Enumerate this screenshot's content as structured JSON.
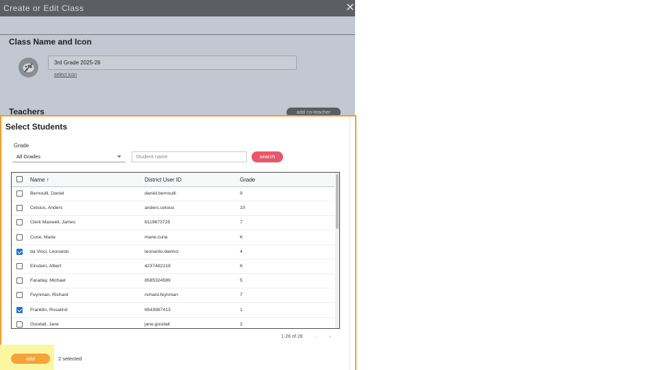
{
  "background_modal": {
    "title": "Create or Edit Class",
    "close_glyph": "✕",
    "section_title": "Class Name and Icon",
    "class_name_value": "3rd Grade 2025-26",
    "select_icon_link": "select icon",
    "teachers_title": "Teachers",
    "add_coteacher_button": "add co-teacher",
    "icon": "palette-icon"
  },
  "panel": {
    "title": "Select Students",
    "grade_label": "Grade",
    "grade_selected": "All Grades",
    "name_placeholder": "Student name",
    "search_button": "search",
    "columns": {
      "name": "Name",
      "sort_glyph": "↑",
      "id": "District User ID",
      "grade": "Grade"
    },
    "rows": [
      {
        "name": "Bernoulli, Daniel",
        "id": "daniel.bernoulli",
        "grade": "9",
        "checked": false
      },
      {
        "name": "Celsius, Anders",
        "id": "anders.celsius",
        "grade": "10",
        "checked": false
      },
      {
        "name": "Clerk Maxwell, James",
        "id": "6119673725",
        "grade": "7",
        "checked": false
      },
      {
        "name": "Curie, Marie",
        "id": "marie.curie",
        "grade": "K",
        "checked": false
      },
      {
        "name": "da Vinci, Leonardo",
        "id": "leonardo.davinci",
        "grade": "4",
        "checked": true
      },
      {
        "name": "Einstein, Albert",
        "id": "4237482219",
        "grade": "K",
        "checked": false
      },
      {
        "name": "Faraday, Michael",
        "id": "8585324589",
        "grade": "5",
        "checked": false
      },
      {
        "name": "Feynman, Richard",
        "id": "richard.feynman",
        "grade": "7",
        "checked": false
      },
      {
        "name": "Franklin, Rosalind",
        "id": "6543987413",
        "grade": "1",
        "checked": true
      },
      {
        "name": "Goodall, Jane",
        "id": "jane.goodall",
        "grade": "2",
        "checked": false
      }
    ],
    "pagination": "1-28 of 28",
    "prev_glyph": "‹",
    "next_glyph": "›",
    "add_button": "add",
    "selected_text": "2 selected"
  },
  "colors": {
    "panel_border": "#f39c2c",
    "search_button": "#e8566a",
    "add_button": "#f6a33a",
    "checkbox_checked": "#1f73c7",
    "highlight": "#fbf7a0"
  }
}
